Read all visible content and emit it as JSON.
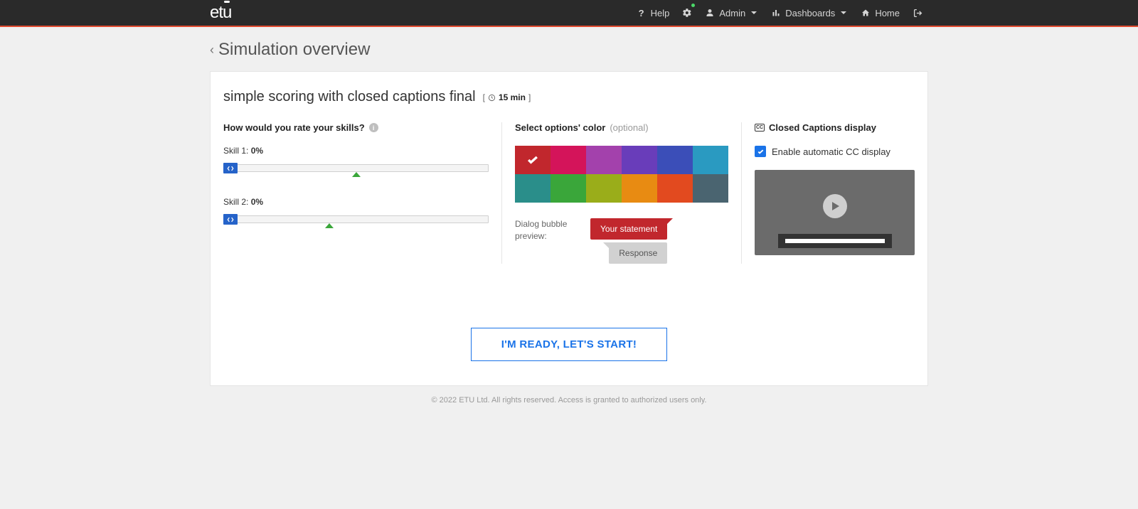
{
  "nav": {
    "logo": "etu",
    "help": "Help",
    "admin": "Admin",
    "dashboards": "Dashboards",
    "home": "Home"
  },
  "breadcrumb": {
    "label": "Simulation overview"
  },
  "simulation": {
    "title": "simple scoring with closed captions final",
    "duration_value": "15 min"
  },
  "skills": {
    "heading": "How would you rate your skills?",
    "items": [
      {
        "label_prefix": "Skill 1: ",
        "value_text": "0%",
        "handle_pct": 0,
        "mark_pct": 50
      },
      {
        "label_prefix": "Skill 2: ",
        "value_text": "0%",
        "handle_pct": 0,
        "mark_pct": 40
      }
    ]
  },
  "colors": {
    "heading": "Select options' color",
    "heading_optional": "(optional)",
    "swatches": [
      {
        "hex": "#c1272d",
        "selected": true
      },
      {
        "hex": "#d4145a",
        "selected": false
      },
      {
        "hex": "#a341ac",
        "selected": false
      },
      {
        "hex": "#693dba",
        "selected": false
      },
      {
        "hex": "#3b4eb8",
        "selected": false
      },
      {
        "hex": "#2a9ac1",
        "selected": false
      },
      {
        "hex": "#2a8e8a",
        "selected": false
      },
      {
        "hex": "#3aa63a",
        "selected": false
      },
      {
        "hex": "#9aad1a",
        "selected": false
      },
      {
        "hex": "#e88b12",
        "selected": false
      },
      {
        "hex": "#e24a1f",
        "selected": false
      },
      {
        "hex": "#4a6470",
        "selected": false
      }
    ],
    "preview_label": "Dialog bubble preview:",
    "statement_text": "Your statement",
    "response_text": "Response"
  },
  "cc": {
    "heading": "Closed Captions display",
    "checkbox_label": "Enable automatic CC display",
    "checked": true
  },
  "start_button": "I'M READY, LET'S START!",
  "footer": "© 2022 ETU Ltd. All rights reserved. Access is granted to authorized users only."
}
